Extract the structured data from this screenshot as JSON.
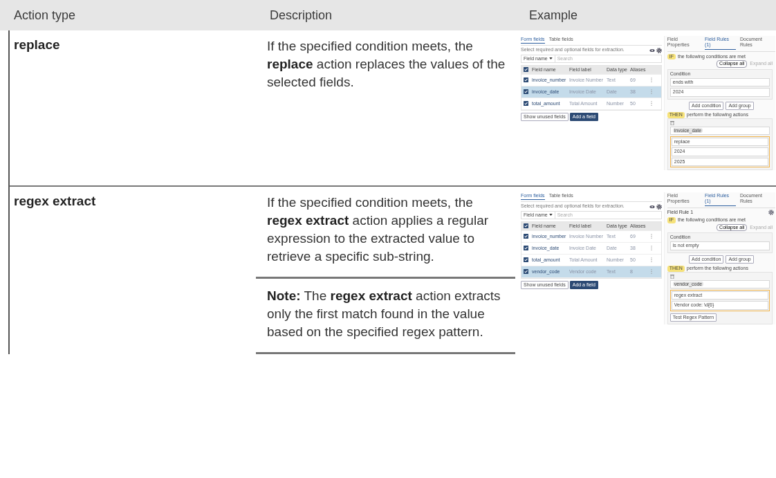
{
  "table": {
    "columns": [
      "Action type",
      "Description",
      "Example"
    ],
    "rows": [
      {
        "action": "replace",
        "description": "If the specified condition meets, the **replace** action replaces the values of the selected fields.",
        "example": {
          "tabs": [
            {
              "label": "Form fields",
              "selected": true
            },
            {
              "label": "Table fields",
              "selected": false
            }
          ],
          "hint": "Select required and optional fields for extraction.",
          "filter": "Field name",
          "search_placeholder": "Search",
          "columns": [
            "Field name",
            "Field label",
            "Data type",
            "Aliases"
          ],
          "all_checked": true,
          "rows": [
            {
              "cells": [
                "invoice_number",
                "Invoice Number",
                "Text",
                "69"
              ],
              "checked": true,
              "selected": false
            },
            {
              "cells": [
                "invoice_date",
                "Invoice Date",
                "Date",
                "38"
              ],
              "checked": true,
              "selected": true
            },
            {
              "cells": [
                "total_amount",
                "Total Amount",
                "Number",
                "50"
              ],
              "checked": true,
              "selected": false
            }
          ],
          "buttons": [
            "Show unused fields",
            "Add a field"
          ],
          "panel_tabs": [
            {
              "label": "Field Properties",
              "selected": false
            },
            {
              "label": "Field Rules (1)",
              "selected": true
            },
            {
              "label": "Document Rules",
              "selected": false
            }
          ],
          "if_badge": "IF",
          "if_text": "the following conditions are met",
          "collapse": "Collapse all",
          "expand": "Expand all",
          "condition_title": "Condition",
          "operator": "ends with",
          "condition_value": "2024",
          "add_buttons": [
            "Add condition",
            "Add group"
          ],
          "then_badge": "THEN",
          "then_text": "perform the following actions",
          "chip": "invoice_date",
          "action": "replace",
          "values": [
            "2024",
            "2025"
          ]
        }
      },
      {
        "action": "regex extract",
        "description": "If the specified condition meets, the **regex extract** action applies a regular expression to the extracted value to retrieve a specific sub-string.",
        "note": "**Note:** The **regex extract** action extracts only the first match found in the value based on the specified regex pattern.",
        "example": {
          "tabs": [
            {
              "label": "Form fields",
              "selected": true
            },
            {
              "label": "Table fields",
              "selected": false
            }
          ],
          "hint": "Select required and optional fields for extraction.",
          "filter": "Field name",
          "search_placeholder": "Search",
          "columns": [
            "Field name",
            "Field label",
            "Data type",
            "Aliases"
          ],
          "all_checked": true,
          "rows": [
            {
              "cells": [
                "invoice_number",
                "Invoice Number",
                "Text",
                "69"
              ],
              "checked": true,
              "selected": false
            },
            {
              "cells": [
                "invoice_date",
                "Invoice Date",
                "Date",
                "38"
              ],
              "checked": true,
              "selected": false
            },
            {
              "cells": [
                "total_amount",
                "Total Amount",
                "Number",
                "50"
              ],
              "checked": true,
              "selected": false
            },
            {
              "cells": [
                "vendor_code",
                "Vendor code",
                "Text",
                "8"
              ],
              "checked": true,
              "selected": true
            }
          ],
          "buttons": [
            "Show unused fields",
            "Add a field"
          ],
          "panel_tabs": [
            {
              "label": "Field Properties",
              "selected": false
            },
            {
              "label": "Field Rules (1)",
              "selected": true
            },
            {
              "label": "Document Rules",
              "selected": false
            }
          ],
          "rule_title": "Field Rule 1",
          "if_badge": "IF",
          "if_text": "the following conditions are met",
          "collapse": "Collapse all",
          "expand": "Expand all",
          "condition_title": "Condition",
          "operator": "is not empty",
          "add_buttons": [
            "Add condition",
            "Add group"
          ],
          "then_badge": "THEN",
          "then_text": "perform the following actions",
          "chip": "vendor_code",
          "action": "regex extract",
          "values": [
            "Vendor code: \\d{6}"
          ],
          "test_button": "Test Regex Pattern"
        }
      }
    ]
  }
}
